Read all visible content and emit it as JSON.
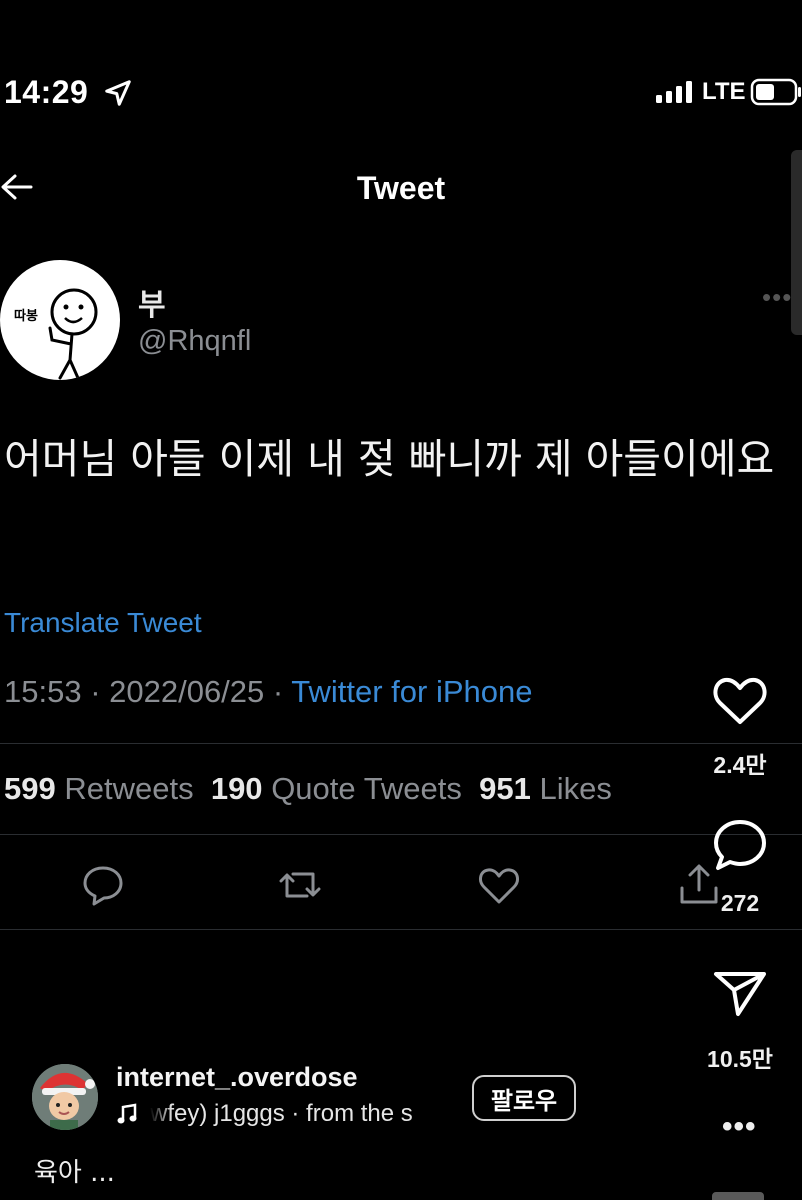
{
  "status_bar": {
    "time": "14:29",
    "network": "LTE"
  },
  "header": {
    "title": "Tweet"
  },
  "author": {
    "display_name": "부",
    "handle": "@Rhqnfl",
    "avatar_badge": "따봉"
  },
  "tweet": {
    "text": "어머님 아들 이제 내 젖 빠니까 제 아들이에요",
    "translate_label": "Translate Tweet",
    "timestamp": "15:53 · 2022/06/25 · ",
    "source": "Twitter for iPhone"
  },
  "stats": {
    "retweets_count": "599",
    "retweets_label": "Retweets",
    "quotes_count": "190",
    "quotes_label": "Quote Tweets",
    "likes_count": "951",
    "likes_label": "Likes"
  },
  "overlay": {
    "like_count": "2.4만",
    "comment_count": "272",
    "share_count": "10.5만",
    "username": "internet_.overdose",
    "music_text": "wfey)      j1gggs · from the s",
    "follow_label": "팔로우",
    "caption": "육아 ..."
  },
  "icons": {
    "back": "arrow-left-icon",
    "location": "location-arrow-icon",
    "signal": "signal-bars-icon",
    "battery": "battery-icon",
    "reply": "reply-icon",
    "retweet": "retweet-icon",
    "like": "heart-icon",
    "share": "share-icon",
    "music": "music-note-icon",
    "send": "send-icon",
    "comment": "comment-bubble-icon"
  },
  "colors": {
    "background": "#000000",
    "link": "#3a8ad6",
    "secondary_text": "#8b8e93"
  }
}
